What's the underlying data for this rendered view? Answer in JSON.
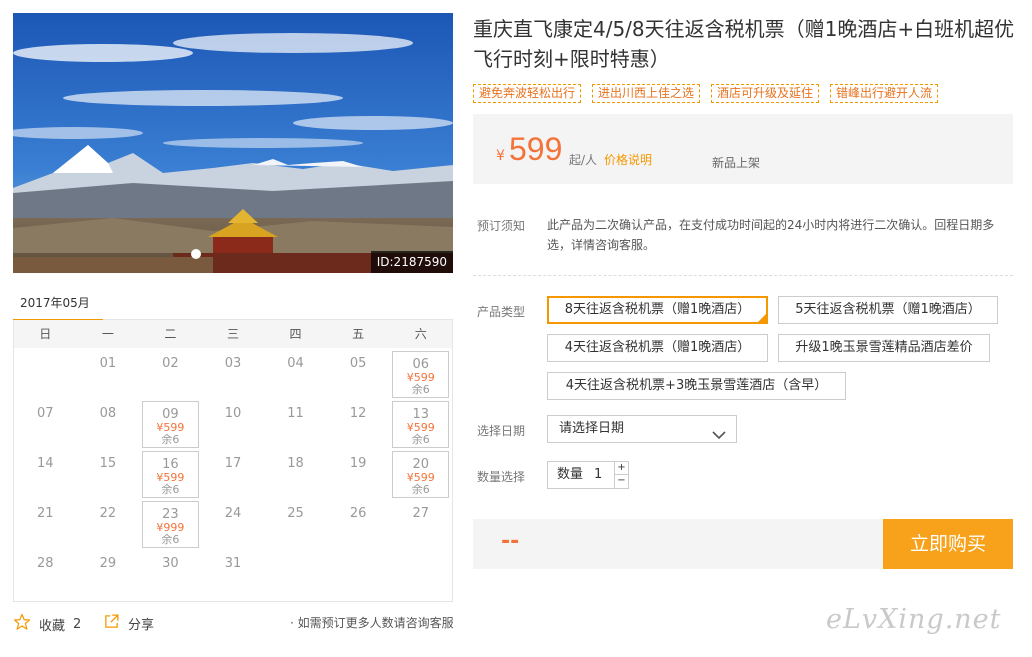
{
  "hero": {
    "id_label": "ID:2187590"
  },
  "product": {
    "title": "重庆直飞康定4/5/8天往返含税机票（赠1晚酒店+白班机超优飞行时刻+限时特惠）",
    "tags": [
      "避免奔波轻松出行",
      "进出川西上佳之选",
      "酒店可升级及延住",
      "错峰出行避开人流"
    ]
  },
  "price": {
    "symbol": "¥",
    "value": "599",
    "unit": "起/人",
    "explain_link": "价格说明",
    "new_label": "新品上架"
  },
  "notice": {
    "label": "预订须知",
    "text": "此产品为二次确认产品，在支付成功时间起的24小时内将进行二次确认。回程日期多选，详情咨询客服。"
  },
  "product_type": {
    "label": "产品类型",
    "options": [
      "8天往返含税机票（赠1晚酒店）",
      "5天往返含税机票（赠1晚酒店）",
      "4天往返含税机票（赠1晚酒店）",
      "升级1晚玉景雪莲精品酒店差价",
      "4天往返含税机票+3晚玉景雪莲酒店（含早）"
    ],
    "selected_index": 0
  },
  "date_select": {
    "label": "选择日期",
    "placeholder": "请选择日期"
  },
  "quantity": {
    "label": "数量选择",
    "inner_label": "数量",
    "value": "1",
    "plus": "+",
    "minus": "−"
  },
  "buy": {
    "price_placeholder": "--",
    "button_label": "立即购买"
  },
  "calendar": {
    "month": "2017年05月",
    "weekdays": [
      "日",
      "一",
      "二",
      "三",
      "四",
      "五",
      "六"
    ],
    "days": [
      {
        "d": ""
      },
      {
        "d": "01"
      },
      {
        "d": "02"
      },
      {
        "d": "03"
      },
      {
        "d": "04"
      },
      {
        "d": "05"
      },
      {
        "d": "06",
        "price": "¥599",
        "remain": "余6"
      },
      {
        "d": "07"
      },
      {
        "d": "08"
      },
      {
        "d": "09",
        "price": "¥599",
        "remain": "余6"
      },
      {
        "d": "10"
      },
      {
        "d": "11"
      },
      {
        "d": "12"
      },
      {
        "d": "13",
        "price": "¥599",
        "remain": "余6"
      },
      {
        "d": "14"
      },
      {
        "d": "15"
      },
      {
        "d": "16",
        "price": "¥599",
        "remain": "余6"
      },
      {
        "d": "17"
      },
      {
        "d": "18"
      },
      {
        "d": "19"
      },
      {
        "d": "20",
        "price": "¥599",
        "remain": "余6"
      },
      {
        "d": "21"
      },
      {
        "d": "22"
      },
      {
        "d": "23",
        "price": "¥999",
        "remain": "余6"
      },
      {
        "d": "24"
      },
      {
        "d": "25"
      },
      {
        "d": "26"
      },
      {
        "d": "27"
      },
      {
        "d": "28"
      },
      {
        "d": "29"
      },
      {
        "d": "30"
      },
      {
        "d": "31"
      }
    ]
  },
  "footer": {
    "favorite_label": "收藏",
    "favorite_count": "2",
    "share_label": "分享",
    "contact_note": "· 如需预订更多人数请咨询客服"
  },
  "watermark": "eLvXing.net",
  "icons": [
    "star-icon",
    "share-icon",
    "chevron-down-icon"
  ],
  "colors": {
    "accent": "#f39800",
    "price": "#f3733a",
    "buy_button": "#f7a21a"
  }
}
